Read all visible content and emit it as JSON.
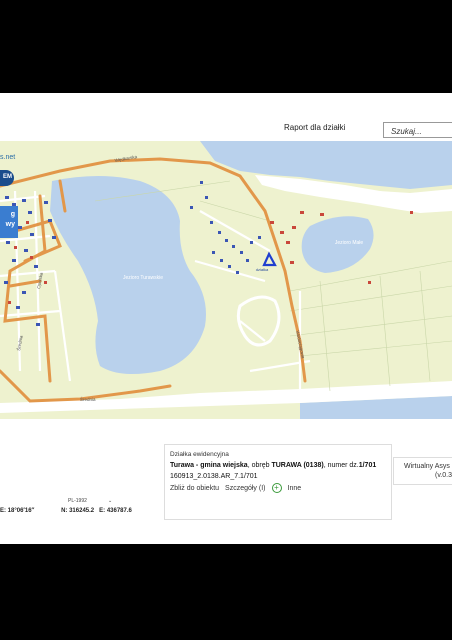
{
  "header": {
    "report_link": "Raport dla działki",
    "search_placeholder": "Szukaj..."
  },
  "logo": {
    "url_fragment": "s.net",
    "badge_text": "EM",
    "blue_text_1": "g",
    "blue_text_2": "wy"
  },
  "map": {
    "lake_main_label": "Jezioro Turawskie",
    "lake_small_label": "Jezioro Małe",
    "marker_label": "działka",
    "street_labels": [
      "Wędkarska",
      "Średnia",
      "Opolska",
      "Średnia",
      "Wodociągowa"
    ],
    "colors": {
      "land": "#eef2cf",
      "water": "#b9d1ec",
      "sand": "#ffffff",
      "road_main": "#e2974a",
      "road_secondary": "#ffffff",
      "building": "#3b56b4",
      "building_alt": "#c9473b",
      "marker": "#1f3fcf"
    }
  },
  "bottom": {
    "scale_select_label": "PL-1992",
    "coord_e_label": "E:",
    "coord_e_value": "18°06′16″",
    "coord_n_label": "N:",
    "coord_n_value": "316245.2",
    "coord_e2_label": "E:",
    "coord_e2_value": "436787.6"
  },
  "parcel": {
    "title": "Działka ewidencyjna",
    "location_bold": "Turawa - gmina wiejska",
    "location_mid": ", obręb ",
    "obreb_bold": "TURAWA (0138)",
    "number_mid": ", numer dz.",
    "number_bold": "1/701",
    "identifier": "160913_2.0138.AR_7.1/701",
    "action_zoom": "Zbliż do obiektu",
    "action_details": "Szczegóły (I)",
    "action_other": "Inne"
  },
  "virtual_assistant": {
    "title": "Wirtualny Asys",
    "version": "(v.0.3"
  }
}
